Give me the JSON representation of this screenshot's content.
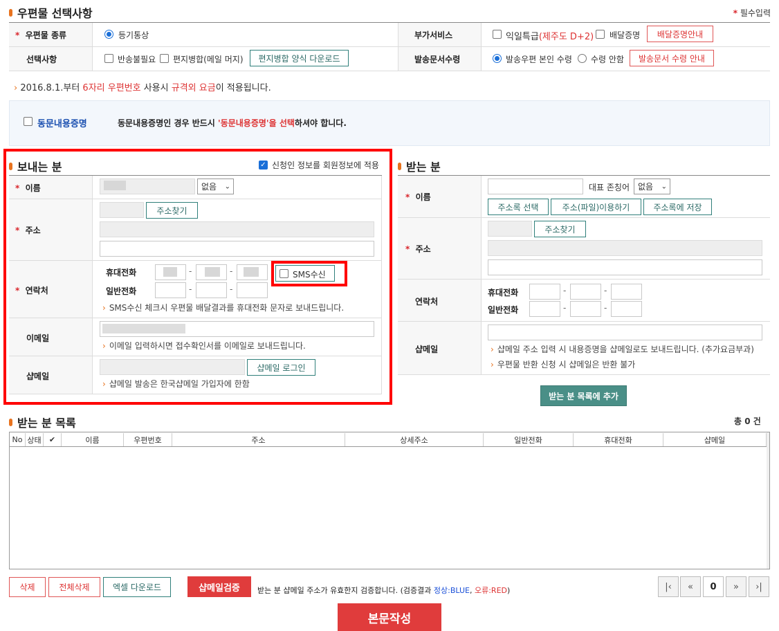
{
  "postal": {
    "title": "우편물 선택사항",
    "required_note": "필수입력",
    "type_label": "우편물 종류",
    "type_value": "등기통상",
    "extra_label": "부가서비스",
    "next_day": "익일특급",
    "next_day_note": "(제주도 D+2)",
    "delivery_proof": "배달증명",
    "delivery_guide_btn": "배달증명안내",
    "options_label": "선택사항",
    "no_return": "반송불필요",
    "merge": "편지병합(메일 머지)",
    "merge_download_btn": "편지병합 양식 다운로드",
    "doc_receipt_label": "발송문서수령",
    "self_receipt": "발송우편 본인 수령",
    "no_receipt": "수령 안함",
    "receipt_guide_btn": "발송문서 수령 안내"
  },
  "notice": {
    "prefix": "2016.8.1.부터 ",
    "red1": "6자리 우편번호",
    "mid": " 사용시 ",
    "red2": "규격외 요금",
    "suffix": "이 적용됩니다."
  },
  "same_content": {
    "label": "동문내용증명",
    "msg_prefix": "동문내용증명인 경우 반드시 ",
    "msg_red": "'동문내용증명'을 선택",
    "msg_suffix": "하셔야 합니다."
  },
  "sender": {
    "title": "보내는 분",
    "apply_member": "신청인 정보를 회원정보에 적용",
    "name_label": "이름",
    "title_select": "없음",
    "addr_label": "주소",
    "addr_btn": "주소찾기",
    "contact_label": "연락처",
    "mobile_label": "휴대전화",
    "phone_label": "일반전화",
    "sms_label": "SMS수신",
    "sms_hint": "SMS수신 체크시 우편물 배달결과를 휴대전화 문자로 보내드립니다.",
    "email_label": "이메일",
    "email_hint": "이메일 입력하시면 접수확인서를 이메일로 보내드립니다.",
    "shopmail_label": "샵메일",
    "shopmail_btn": "샵메일 로그인",
    "shopmail_hint": "샵메일 발송은 한국샵메일 가입자에 한함"
  },
  "receiver": {
    "title": "받는 분",
    "name_label": "이름",
    "honorific_label": "대표 존칭어",
    "honorific_select": "없음",
    "addrbook_btn": "주소록 선택",
    "file_btn": "주소(파일)이용하기",
    "save_btn": "주소록에 저장",
    "addr_label": "주소",
    "addr_btn": "주소찾기",
    "contact_label": "연락처",
    "mobile_label": "휴대전화",
    "phone_label": "일반전화",
    "shopmail_label": "샵메일",
    "shopmail_hint1": "샵메일 주소 입력 시 내용증명을 샵메일로도 보내드립니다. (추가요금부과)",
    "shopmail_hint2": "우편물 반환 신청 시 샵메일은 반환 불가",
    "add_btn": "받는 분 목록에 추가"
  },
  "list": {
    "title": "받는 분 목록",
    "total": "총 0 건",
    "columns": [
      "No",
      "상태",
      "✔",
      "이름",
      "우편번호",
      "주소",
      "상세주소",
      "일반전화",
      "휴대전화",
      "샵메일"
    ]
  },
  "actions": {
    "delete": "삭제",
    "delete_all": "전체삭제",
    "excel": "엑셀 다운로드",
    "verify": "샵메일검증",
    "verify_msg_prefix": "받는 분 샵메일 주소가 유효한지 검증합니다. (검증결과 ",
    "verify_ok": "정상:BLUE",
    "verify_sep": ", ",
    "verify_err": "오류:RED",
    "verify_msg_suffix": ")",
    "page": "0",
    "compose": "본문작성"
  }
}
